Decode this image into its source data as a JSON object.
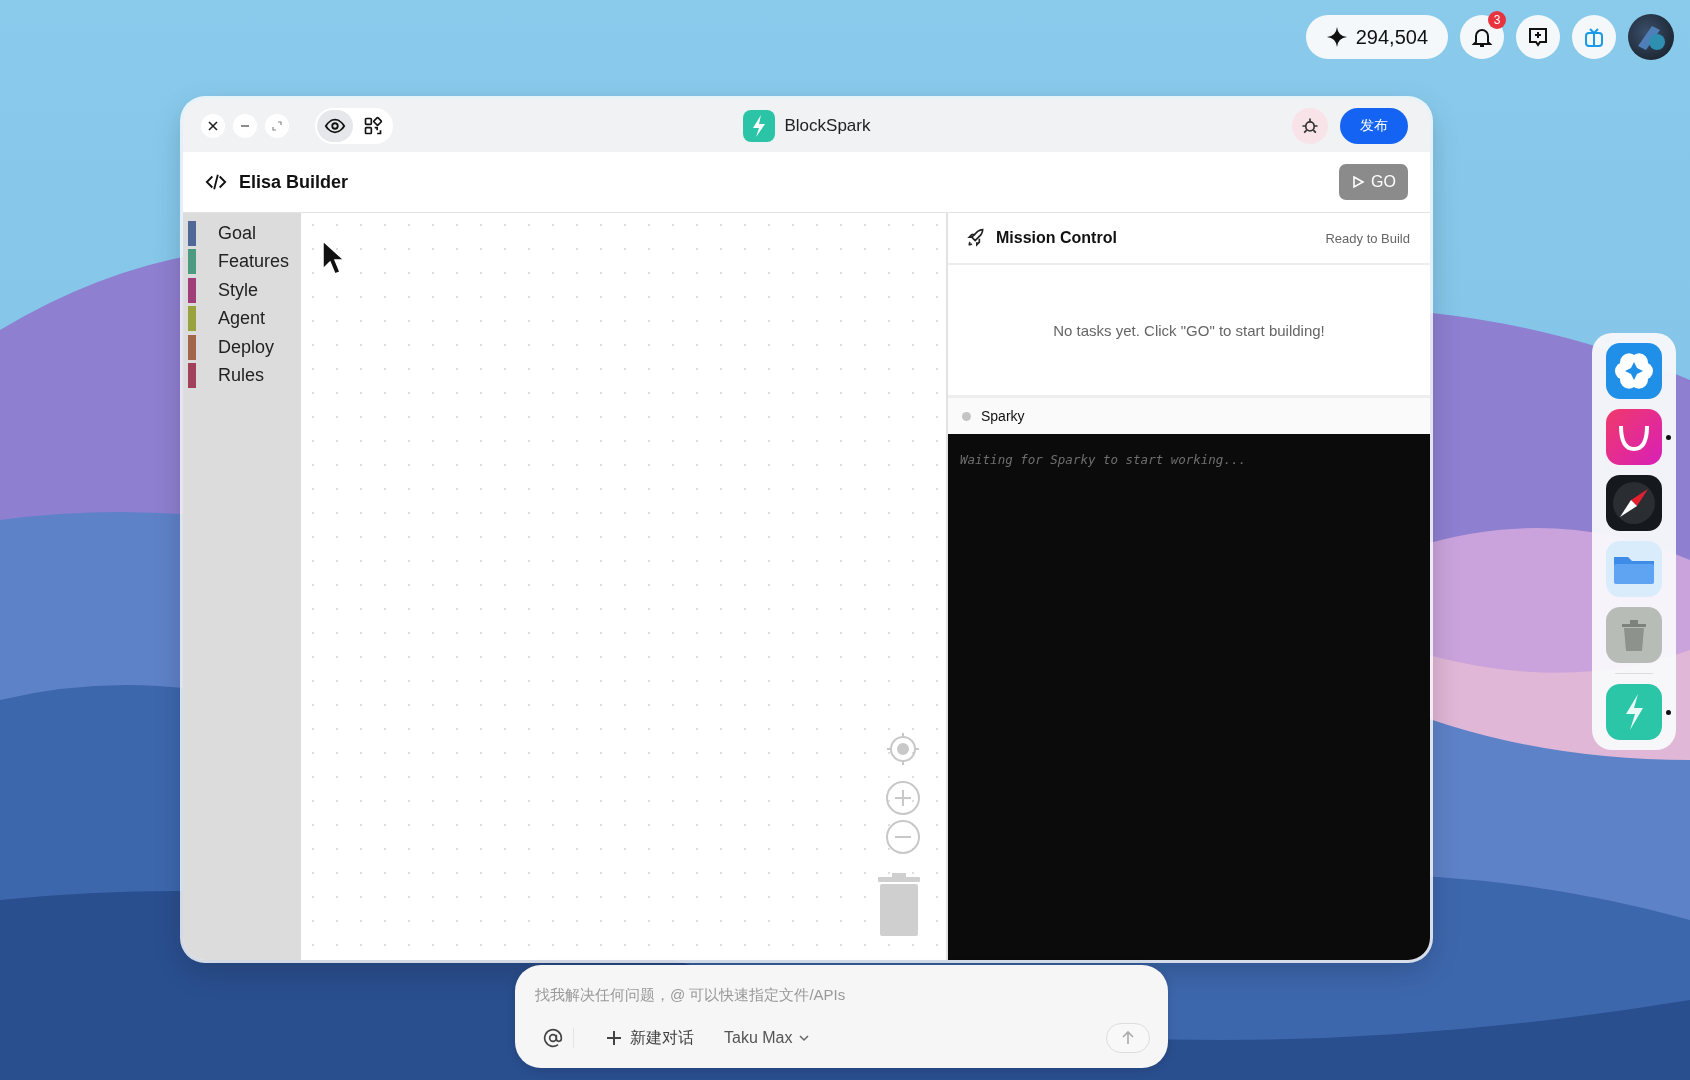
{
  "status_tray": {
    "credits": "294,504",
    "notifications": "3"
  },
  "window": {
    "title": "BlockSpark",
    "publish": "发布",
    "toolbar": [
      {
        "kind": "preview",
        "selected": true
      },
      {
        "kind": "qr",
        "selected": false
      }
    ]
  },
  "builder": {
    "title": "Elisa Builder",
    "go": "GO",
    "disabled": true
  },
  "categories": [
    {
      "label": "Goal",
      "color": "#4f6898"
    },
    {
      "label": "Features",
      "color": "#4e9a80"
    },
    {
      "label": "Style",
      "color": "#a03e7a"
    },
    {
      "label": "Agent",
      "color": "#9aa240"
    },
    {
      "label": "Deploy",
      "color": "#a2654b"
    },
    {
      "label": "Rules",
      "color": "#a2415b"
    }
  ],
  "mission_control": {
    "title": "Mission Control",
    "status": "Ready to Build",
    "empty": "No tasks yet. Click \"GO\" to start building!"
  },
  "agent": {
    "name": "Sparky",
    "active": false,
    "log": "Waiting for Sparky to start working..."
  },
  "chat": {
    "placeholder": "找我解决任何问题，@ 可以快速指定文件/APIs",
    "new_chat": "新建对话",
    "model": "Taku Max"
  },
  "dock": [
    {
      "kind": "star",
      "running": false
    },
    {
      "kind": "bag",
      "running": true
    },
    {
      "kind": "compass",
      "running": false
    },
    {
      "kind": "folder",
      "running": false
    },
    {
      "kind": "trash",
      "running": false
    },
    {
      "kind": "bolt",
      "running": true
    }
  ]
}
